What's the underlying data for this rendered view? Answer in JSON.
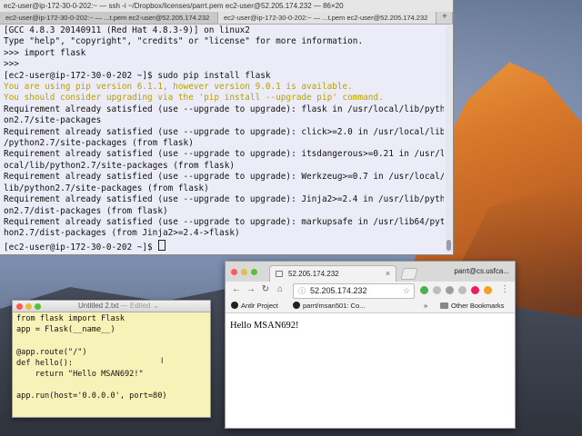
{
  "terminal": {
    "window_title": "ec2-user@ip-172-30-0-202:~ — ssh -i ~/Dropbox/licenses/parrt.pem ec2-user@52.205.174.232 — 86×20",
    "tabs": [
      "ec2-user@ip-172-30-0-202:~ — ...t.pem ec2-user@52.205.174.232",
      "ec2-user@ip-172-30-0-202:~ — ...t.pem ec2-user@52.205.174.232"
    ],
    "new_tab_label": "+",
    "lines": [
      {
        "text": "[GCC 4.8.3 20140911 (Red Hat 4.8.3-9)] on linux2",
        "style": "normal"
      },
      {
        "text": "Type \"help\", \"copyright\", \"credits\" or \"license\" for more information.",
        "style": "normal"
      },
      {
        "text": ">>> import flask",
        "style": "normal"
      },
      {
        "text": ">>>",
        "style": "normal"
      },
      {
        "text": "[ec2-user@ip-172-30-0-202 ~]$ sudo pip install flask",
        "style": "normal"
      },
      {
        "text": "You are using pip version 6.1.1, however version 9.0.1 is available.",
        "style": "warn"
      },
      {
        "text": "You should consider upgrading via the 'pip install --upgrade pip' command.",
        "style": "warn"
      },
      {
        "text": "Requirement already satisfied (use --upgrade to upgrade): flask in /usr/local/lib/pyth",
        "style": "normal"
      },
      {
        "text": "on2.7/site-packages",
        "style": "normal"
      },
      {
        "text": "Requirement already satisfied (use --upgrade to upgrade): click>=2.0 in /usr/local/lib",
        "style": "normal"
      },
      {
        "text": "/python2.7/site-packages (from flask)",
        "style": "normal"
      },
      {
        "text": "Requirement already satisfied (use --upgrade to upgrade): itsdangerous>=0.21 in /usr/l",
        "style": "normal"
      },
      {
        "text": "ocal/lib/python2.7/site-packages (from flask)",
        "style": "normal"
      },
      {
        "text": "Requirement already satisfied (use --upgrade to upgrade): Werkzeug>=0.7 in /usr/local/",
        "style": "normal"
      },
      {
        "text": "lib/python2.7/site-packages (from flask)",
        "style": "normal"
      },
      {
        "text": "Requirement already satisfied (use --upgrade to upgrade): Jinja2>=2.4 in /usr/lib/pyth",
        "style": "normal"
      },
      {
        "text": "on2.7/dist-packages (from flask)",
        "style": "normal"
      },
      {
        "text": "Requirement already satisfied (use --upgrade to upgrade): markupsafe in /usr/lib64/pyt",
        "style": "normal"
      },
      {
        "text": "hon2.7/dist-packages (from Jinja2>=2.4->flask)",
        "style": "normal"
      },
      {
        "text": "[ec2-user@ip-172-30-0-202 ~]$ ",
        "style": "prompt"
      }
    ]
  },
  "editor": {
    "title": "Untitled 2.txt",
    "status": " — Edited",
    "status_arrow": "⌄",
    "lines": [
      "from flask import Flask",
      "app = Flask(__name__)",
      "",
      "@app.route(\"/\")",
      "def hello():",
      "    return \"Hello MSAN692!\"",
      "",
      "app.run(host='0.0.0.0', port=80)"
    ],
    "cursor_glyph": "I"
  },
  "browser": {
    "tab_title": "52.205.174.232",
    "tab_close": "×",
    "profile_name": "parrt@cs.usfca...",
    "url": "52.205.174.232",
    "bookmarks": [
      "Antlr Project",
      "parrt/msan501: Co..."
    ],
    "bookmarks_overflow": "»",
    "other_bookmarks": "Other Bookmarks",
    "page_text": "Hello MSAN692!",
    "nav": {
      "back": "←",
      "forward": "→",
      "reload": "↻",
      "home": "⌂"
    },
    "menu_glyph": "⋮",
    "info_icon": "ⓘ",
    "star_icon": "☆",
    "extension_colors": [
      "#4caf50",
      "#bdbdbd",
      "#9e9e9e",
      "#bdbdbd",
      "#e91e63",
      "#f4a024"
    ]
  }
}
